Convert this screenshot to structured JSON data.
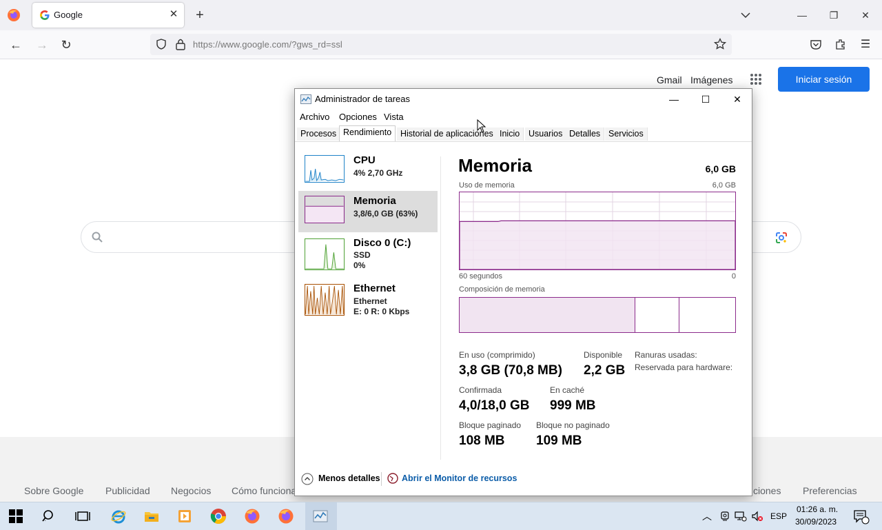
{
  "browser": {
    "tab_title": "Google",
    "url": "https://www.google.com/?gws_rd=ssl"
  },
  "google": {
    "gmail": "Gmail",
    "images": "Imágenes",
    "signin": "Iniciar sesión",
    "footer_links": [
      "Sobre Google",
      "Publicidad",
      "Negocios",
      "Cómo funciona",
      "ciones",
      "Preferencias"
    ]
  },
  "taskmgr": {
    "title": "Administrador de tareas",
    "menu": [
      "Archivo",
      "Opciones",
      "Vista"
    ],
    "tabs": [
      "Procesos",
      "Rendimiento",
      "Historial de aplicaciones",
      "Inicio",
      "Usuarios",
      "Detalles",
      "Servicios"
    ],
    "resources": [
      {
        "name": "CPU",
        "line1": "4%  2,70 GHz",
        "line2": ""
      },
      {
        "name": "Memoria",
        "line1": "3,8/6,0 GB (63%)",
        "line2": ""
      },
      {
        "name": "Disco 0 (C:)",
        "line1": "SSD",
        "line2": "0%"
      },
      {
        "name": "Ethernet",
        "line1": "Ethernet",
        "line2": "E: 0  R: 0 Kbps"
      }
    ],
    "memory": {
      "title": "Memoria",
      "total": "6,0 GB",
      "usage_label": "Uso de memoria",
      "usage_max": "6,0 GB",
      "time_label": "60 segundos",
      "time_zero": "0",
      "composition_label": "Composición de memoria",
      "in_use_label": "En uso (comprimido)",
      "in_use_value": "3,8 GB (70,8 MB)",
      "available_label": "Disponible",
      "available_value": "2,2 GB",
      "slots_label": "Ranuras usadas:",
      "reserved_label": "Reservada para hardware:",
      "committed_label": "Confirmada",
      "committed_value": "4,0/18,0 GB",
      "cached_label": "En caché",
      "cached_value": "999 MB",
      "paged_label": "Bloque paginado",
      "paged_value": "108 MB",
      "nonpaged_label": "Bloque no paginado",
      "nonpaged_value": "109 MB",
      "usage_fraction": 0.63
    },
    "footer": {
      "less_details": "Menos detalles",
      "resource_monitor": "Abrir el Monitor de recursos"
    }
  },
  "taskbar": {
    "lang": "ESP",
    "time": "01:26 a. m.",
    "date": "30/09/2023"
  },
  "colors": {
    "accent": "#1a73e8",
    "memory": "#8b2a8b",
    "cpu": "#1e82c8",
    "disk": "#4da033",
    "ethernet": "#a74f01"
  }
}
